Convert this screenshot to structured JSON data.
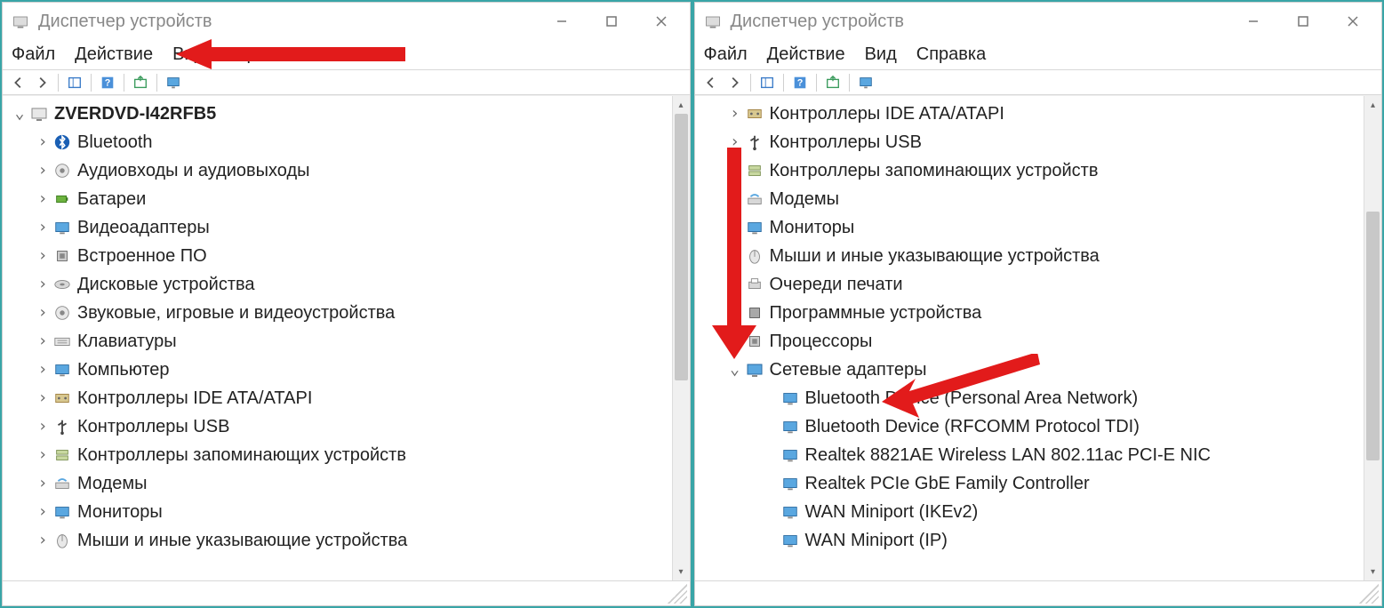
{
  "title": "Диспетчер устройств",
  "menu": {
    "file": "Файл",
    "action": "Действие",
    "view": "Вид",
    "help": "Справка"
  },
  "left": {
    "root": "ZVERDVD-I42RFB5",
    "items": [
      {
        "label": "Bluetooth",
        "icon": "bt"
      },
      {
        "label": "Аудиовходы и аудиовыходы",
        "icon": "audio"
      },
      {
        "label": "Батареи",
        "icon": "battery"
      },
      {
        "label": "Видеоадаптеры",
        "icon": "display"
      },
      {
        "label": "Встроенное ПО",
        "icon": "chip"
      },
      {
        "label": "Дисковые устройства",
        "icon": "disk"
      },
      {
        "label": "Звуковые, игровые и видеоустройства",
        "icon": "audio"
      },
      {
        "label": "Клавиатуры",
        "icon": "keyboard"
      },
      {
        "label": "Компьютер",
        "icon": "monitor"
      },
      {
        "label": "Контроллеры IDE ATA/ATAPI",
        "icon": "ide"
      },
      {
        "label": "Контроллеры USB",
        "icon": "usb"
      },
      {
        "label": "Контроллеры запоминающих устройств",
        "icon": "storage"
      },
      {
        "label": "Модемы",
        "icon": "modem"
      },
      {
        "label": "Мониторы",
        "icon": "monitor"
      },
      {
        "label": "Мыши и иные указывающие устройства",
        "icon": "mouse"
      }
    ]
  },
  "right": {
    "top_items": [
      {
        "label": "Контроллеры IDE ATA/ATAPI",
        "icon": "ide"
      },
      {
        "label": "Контроллеры USB",
        "icon": "usb"
      },
      {
        "label": "Контроллеры запоминающих устройств",
        "icon": "storage"
      },
      {
        "label": "Модемы",
        "icon": "modem"
      },
      {
        "label": "Мониторы",
        "icon": "monitor"
      },
      {
        "label": "Мыши и иные указывающие устройства",
        "icon": "mouse"
      },
      {
        "label": "Очереди печати",
        "icon": "printer"
      },
      {
        "label": "Программные устройства",
        "icon": "software"
      },
      {
        "label": "Процессоры",
        "icon": "cpu"
      }
    ],
    "net_category": "Сетевые адаптеры",
    "net_items": [
      "Bluetooth Device (Personal Area Network)",
      "Bluetooth Device (RFCOMM Protocol TDI)",
      "Realtek 8821AE Wireless LAN 802.11ac PCI-E NIC",
      "Realtek PCIe GbE Family Controller",
      "WAN Miniport (IKEv2)",
      "WAN Miniport (IP)"
    ]
  }
}
